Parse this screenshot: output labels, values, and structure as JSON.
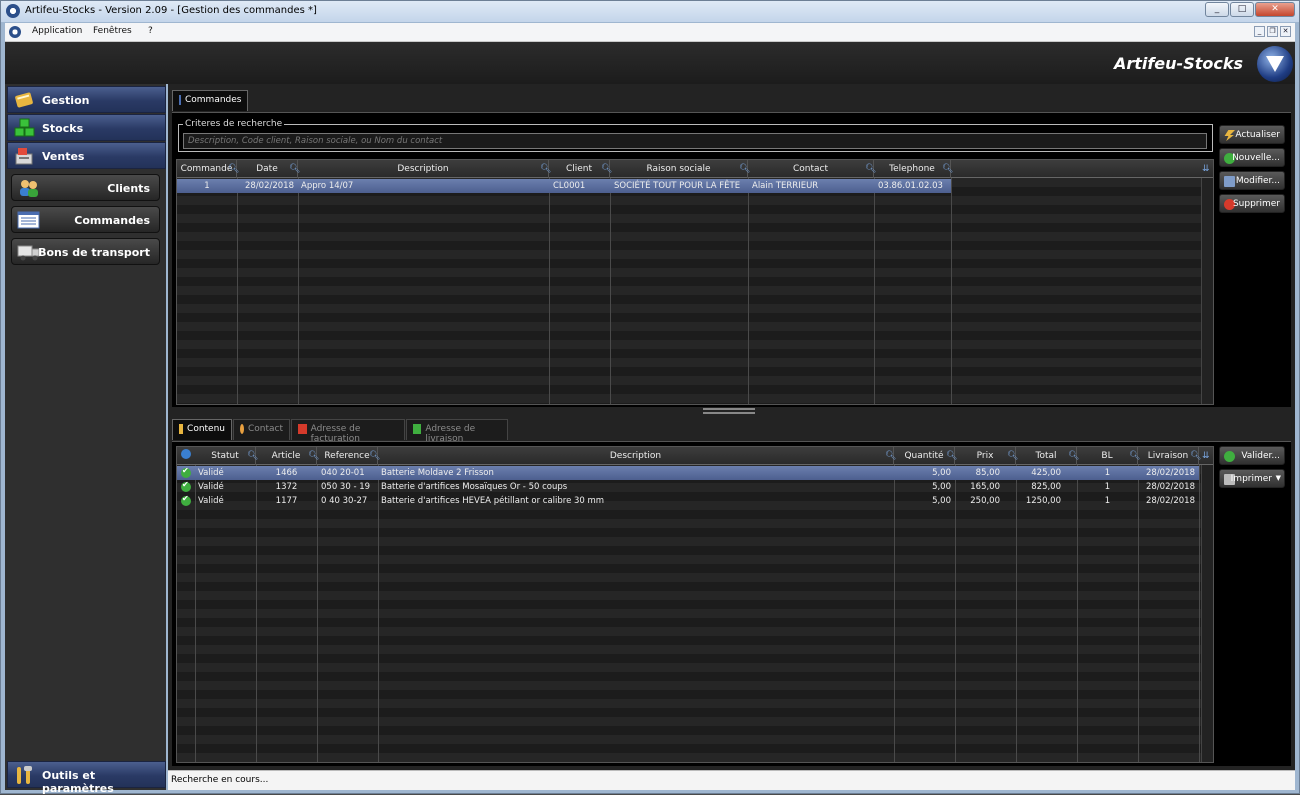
{
  "window": {
    "title": "Artifeu-Stocks - Version 2.09 - [Gestion des commandes *]",
    "controls": [
      "_",
      "□",
      "✕"
    ]
  },
  "menu": {
    "items": [
      "Application",
      "Fenêtres",
      "?"
    ]
  },
  "brand": "Artifeu-Stocks",
  "sidebar": {
    "categories": [
      {
        "label": "Gestion",
        "icon": "book-icon"
      },
      {
        "label": "Stocks",
        "icon": "boxes-icon"
      },
      {
        "label": "Ventes",
        "icon": "cash-register-icon"
      }
    ],
    "items": [
      {
        "label": "Clients",
        "icon": "users-icon"
      },
      {
        "label": "Commandes",
        "icon": "list-icon"
      },
      {
        "label": "Bons de transport",
        "icon": "truck-icon"
      }
    ],
    "footer": {
      "label": "Outils et paramètres",
      "icon": "tools-icon"
    }
  },
  "top_tab": "Commandes",
  "criteria": {
    "legend": "Criteres de recherche",
    "placeholder": "Description, Code client, Raison sociale, ou Nom du contact"
  },
  "orders": {
    "columns": [
      "Commande",
      "Date",
      "Description",
      "Client",
      "Raison sociale",
      "Contact",
      "Telephone"
    ],
    "rows": [
      [
        "1",
        "28/02/2018",
        "Appro 14/07",
        "CL0001",
        "SOCIÉTÉ TOUT POUR LA FÊTE",
        "Alain TERRIEUR",
        "03.86.01.02.03"
      ]
    ]
  },
  "actions": [
    "Actualiser",
    "Nouvelle...",
    "Modifier...",
    "Supprimer"
  ],
  "bottom_tabs": [
    "Contenu",
    "Contact",
    "Adresse de facturation",
    "Adresse de livraison"
  ],
  "lines": {
    "columns": [
      "Statut",
      "Article",
      "Reference",
      "Description",
      "Quantité",
      "Prix",
      "Total",
      "BL",
      "Livraison"
    ],
    "rows": [
      [
        "Validé",
        "1466",
        "040 20-01",
        "Batterie Moldave 2 Frisson",
        "5,00",
        "85,00",
        "425,00",
        "1",
        "28/02/2018"
      ],
      [
        "Validé",
        "1372",
        "050 30 - 19",
        "Batterie d'artifices Mosaïques Or - 50 coups",
        "5,00",
        "165,00",
        "825,00",
        "1",
        "28/02/2018"
      ],
      [
        "Validé",
        "1177",
        "0 40 30-27",
        "Batterie d'artifices HEVEA pétillant or calibre 30 mm",
        "5,00",
        "250,00",
        "1250,00",
        "1",
        "28/02/2018"
      ]
    ]
  },
  "line_actions": [
    "Valider...",
    "Imprimer"
  ],
  "status": "Recherche en cours..."
}
